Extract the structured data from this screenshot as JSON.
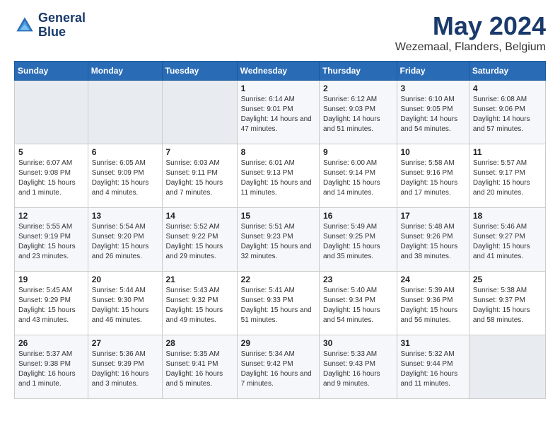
{
  "logo": {
    "line1": "General",
    "line2": "Blue"
  },
  "title": "May 2024",
  "subtitle": "Wezemaal, Flanders, Belgium",
  "days_of_week": [
    "Sunday",
    "Monday",
    "Tuesday",
    "Wednesday",
    "Thursday",
    "Friday",
    "Saturday"
  ],
  "weeks": [
    [
      {
        "day": "",
        "empty": true
      },
      {
        "day": "",
        "empty": true
      },
      {
        "day": "",
        "empty": true
      },
      {
        "day": "1",
        "sunrise": "6:14 AM",
        "sunset": "9:01 PM",
        "daylight": "14 hours and 47 minutes."
      },
      {
        "day": "2",
        "sunrise": "6:12 AM",
        "sunset": "9:03 PM",
        "daylight": "14 hours and 51 minutes."
      },
      {
        "day": "3",
        "sunrise": "6:10 AM",
        "sunset": "9:05 PM",
        "daylight": "14 hours and 54 minutes."
      },
      {
        "day": "4",
        "sunrise": "6:08 AM",
        "sunset": "9:06 PM",
        "daylight": "14 hours and 57 minutes."
      }
    ],
    [
      {
        "day": "5",
        "sunrise": "6:07 AM",
        "sunset": "9:08 PM",
        "daylight": "15 hours and 1 minute."
      },
      {
        "day": "6",
        "sunrise": "6:05 AM",
        "sunset": "9:09 PM",
        "daylight": "15 hours and 4 minutes."
      },
      {
        "day": "7",
        "sunrise": "6:03 AM",
        "sunset": "9:11 PM",
        "daylight": "15 hours and 7 minutes."
      },
      {
        "day": "8",
        "sunrise": "6:01 AM",
        "sunset": "9:13 PM",
        "daylight": "15 hours and 11 minutes."
      },
      {
        "day": "9",
        "sunrise": "6:00 AM",
        "sunset": "9:14 PM",
        "daylight": "15 hours and 14 minutes."
      },
      {
        "day": "10",
        "sunrise": "5:58 AM",
        "sunset": "9:16 PM",
        "daylight": "15 hours and 17 minutes."
      },
      {
        "day": "11",
        "sunrise": "5:57 AM",
        "sunset": "9:17 PM",
        "daylight": "15 hours and 20 minutes."
      }
    ],
    [
      {
        "day": "12",
        "sunrise": "5:55 AM",
        "sunset": "9:19 PM",
        "daylight": "15 hours and 23 minutes."
      },
      {
        "day": "13",
        "sunrise": "5:54 AM",
        "sunset": "9:20 PM",
        "daylight": "15 hours and 26 minutes."
      },
      {
        "day": "14",
        "sunrise": "5:52 AM",
        "sunset": "9:22 PM",
        "daylight": "15 hours and 29 minutes."
      },
      {
        "day": "15",
        "sunrise": "5:51 AM",
        "sunset": "9:23 PM",
        "daylight": "15 hours and 32 minutes."
      },
      {
        "day": "16",
        "sunrise": "5:49 AM",
        "sunset": "9:25 PM",
        "daylight": "15 hours and 35 minutes."
      },
      {
        "day": "17",
        "sunrise": "5:48 AM",
        "sunset": "9:26 PM",
        "daylight": "15 hours and 38 minutes."
      },
      {
        "day": "18",
        "sunrise": "5:46 AM",
        "sunset": "9:27 PM",
        "daylight": "15 hours and 41 minutes."
      }
    ],
    [
      {
        "day": "19",
        "sunrise": "5:45 AM",
        "sunset": "9:29 PM",
        "daylight": "15 hours and 43 minutes."
      },
      {
        "day": "20",
        "sunrise": "5:44 AM",
        "sunset": "9:30 PM",
        "daylight": "15 hours and 46 minutes."
      },
      {
        "day": "21",
        "sunrise": "5:43 AM",
        "sunset": "9:32 PM",
        "daylight": "15 hours and 49 minutes."
      },
      {
        "day": "22",
        "sunrise": "5:41 AM",
        "sunset": "9:33 PM",
        "daylight": "15 hours and 51 minutes."
      },
      {
        "day": "23",
        "sunrise": "5:40 AM",
        "sunset": "9:34 PM",
        "daylight": "15 hours and 54 minutes."
      },
      {
        "day": "24",
        "sunrise": "5:39 AM",
        "sunset": "9:36 PM",
        "daylight": "15 hours and 56 minutes."
      },
      {
        "day": "25",
        "sunrise": "5:38 AM",
        "sunset": "9:37 PM",
        "daylight": "15 hours and 58 minutes."
      }
    ],
    [
      {
        "day": "26",
        "sunrise": "5:37 AM",
        "sunset": "9:38 PM",
        "daylight": "16 hours and 1 minute."
      },
      {
        "day": "27",
        "sunrise": "5:36 AM",
        "sunset": "9:39 PM",
        "daylight": "16 hours and 3 minutes."
      },
      {
        "day": "28",
        "sunrise": "5:35 AM",
        "sunset": "9:41 PM",
        "daylight": "16 hours and 5 minutes."
      },
      {
        "day": "29",
        "sunrise": "5:34 AM",
        "sunset": "9:42 PM",
        "daylight": "16 hours and 7 minutes."
      },
      {
        "day": "30",
        "sunrise": "5:33 AM",
        "sunset": "9:43 PM",
        "daylight": "16 hours and 9 minutes."
      },
      {
        "day": "31",
        "sunrise": "5:32 AM",
        "sunset": "9:44 PM",
        "daylight": "16 hours and 11 minutes."
      },
      {
        "day": "",
        "empty": true
      }
    ]
  ]
}
